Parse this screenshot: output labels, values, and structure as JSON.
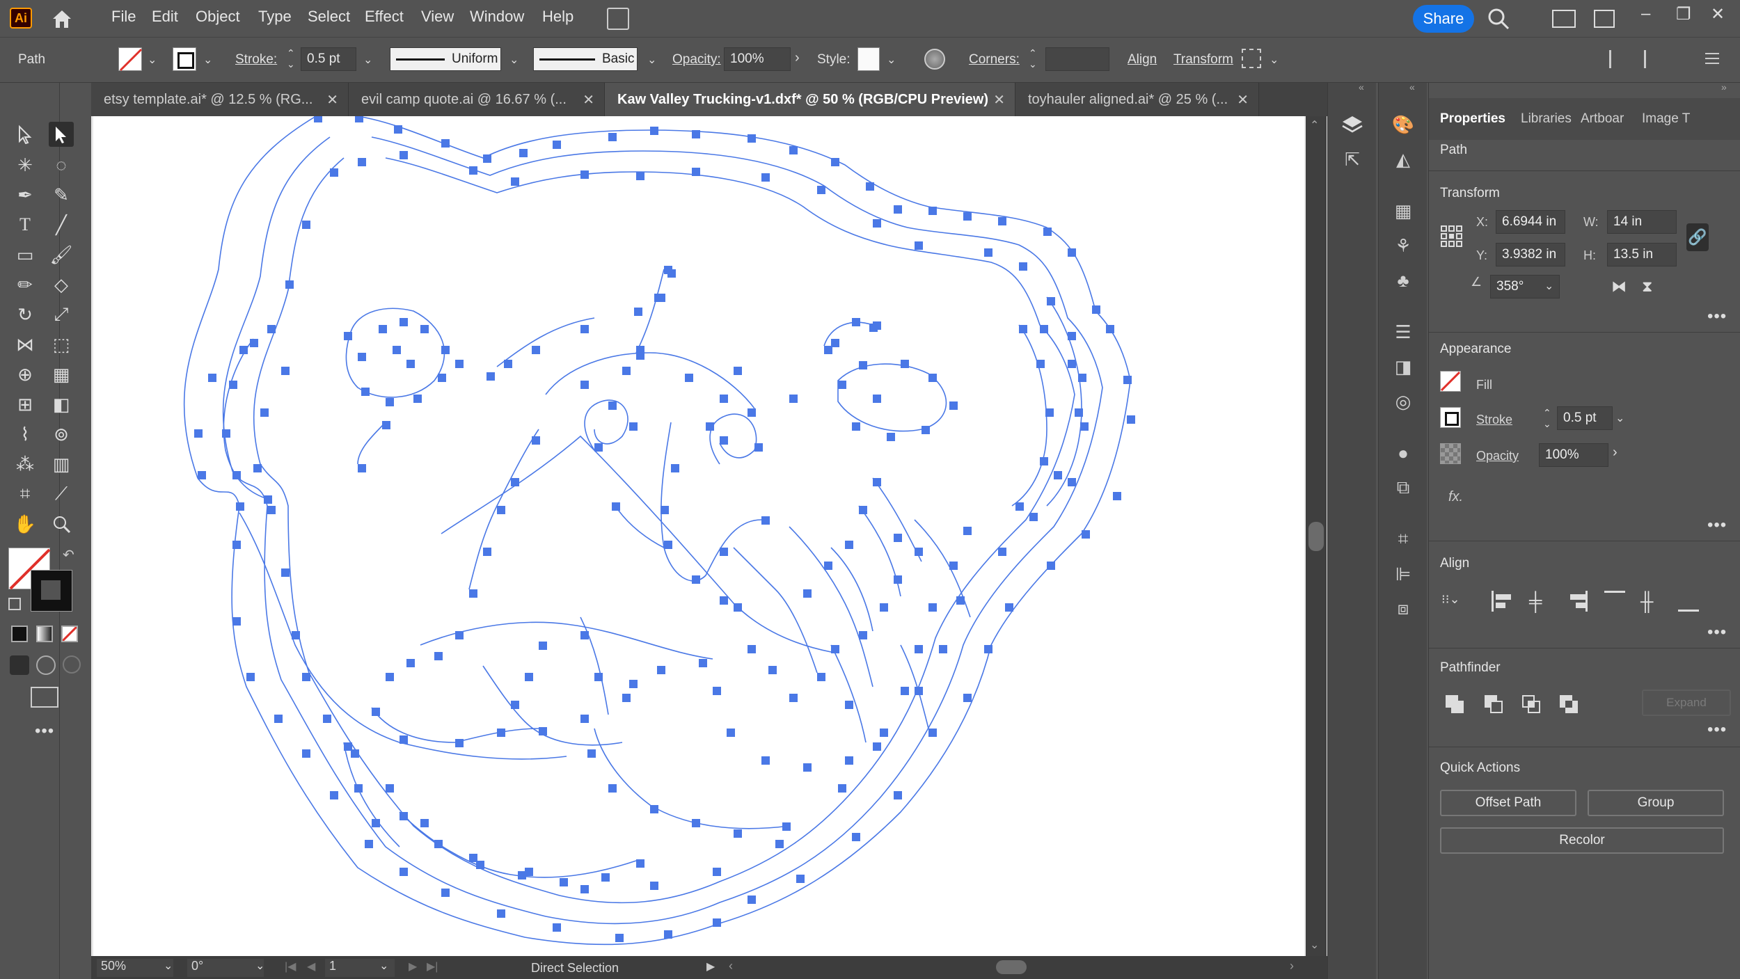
{
  "app": {
    "logo": "Ai"
  },
  "menu": [
    "File",
    "Edit",
    "Object",
    "Type",
    "Select",
    "Effect",
    "View",
    "Window",
    "Help"
  ],
  "share_label": "Share",
  "control_bar": {
    "selection_type": "Path",
    "stroke_label": "Stroke:",
    "stroke_value": "0.5 pt",
    "profile_label": "Uniform",
    "brush_label": "Basic",
    "opacity_label": "Opacity:",
    "opacity_value": "100%",
    "style_label": "Style:",
    "corners_label": "Corners:",
    "align_label": "Align",
    "transform_label": "Transform"
  },
  "tabs": [
    {
      "label": "etsy template.ai* @ 12.5 % (RG...",
      "active": false
    },
    {
      "label": "evil camp quote.ai @ 16.67 % (...",
      "active": false
    },
    {
      "label": "Kaw Valley Trucking-v1.dxf* @ 50 % (RGB/CPU Preview)",
      "active": true
    },
    {
      "label": "toyhauler aligned.ai* @ 25 % (...",
      "active": false
    }
  ],
  "status_bar": {
    "zoom": "50%",
    "rotation": "0°",
    "artboard_number": "1",
    "tool_name": "Direct Selection"
  },
  "properties_panel": {
    "tabs": [
      "Properties",
      "Libraries",
      "Artboar",
      "Image T"
    ],
    "object_type": "Path",
    "transform": {
      "title": "Transform",
      "x_label": "X:",
      "x": "6.6944 in",
      "y_label": "Y:",
      "y": "3.9382 in",
      "w_label": "W:",
      "w": "14 in",
      "h_label": "H:",
      "h": "13.5 in",
      "angle": "358°"
    },
    "appearance": {
      "title": "Appearance",
      "fill_label": "Fill",
      "stroke_label": "Stroke",
      "stroke_value": "0.5 pt",
      "opacity_label": "Opacity",
      "opacity_value": "100%",
      "fx_label": "fx."
    },
    "align_title": "Align",
    "pathfinder": {
      "title": "Pathfinder",
      "expand_label": "Expand"
    },
    "quick_actions": {
      "title": "Quick Actions",
      "offset_path": "Offset Path",
      "group": "Group",
      "recolor": "Recolor"
    }
  },
  "colors": {
    "ui_bg": "#535353",
    "accent_share": "#1473e6",
    "path_stroke": "#4a78e6",
    "anchor": "#4a78e6",
    "stroke_none_red": "#e0302a"
  }
}
